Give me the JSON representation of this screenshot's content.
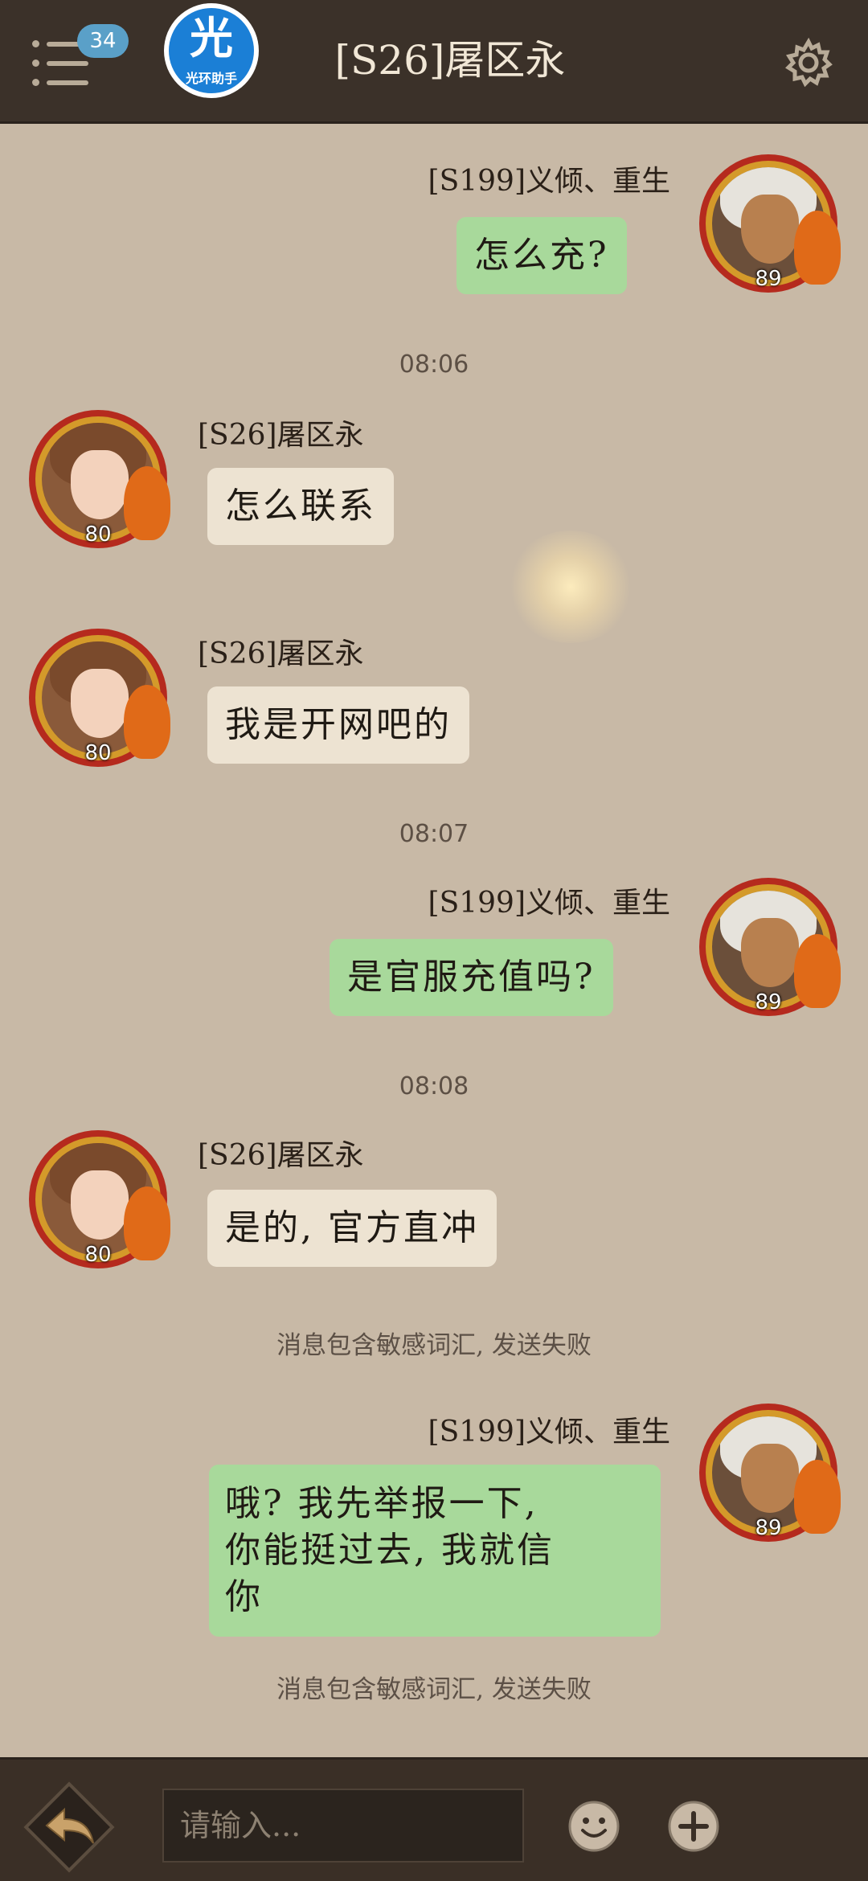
{
  "header": {
    "unread_count": "34",
    "app_logo_glyph": "光",
    "app_logo_caption": "光环助手",
    "title": "[S26]屠区永"
  },
  "messages": {
    "m1": {
      "sender": "[S199]义倾、重生",
      "text": "怎么充?",
      "level": "89"
    },
    "t1": "08:06",
    "m2": {
      "sender": "[S26]屠区永",
      "text": "怎么联系",
      "level": "80"
    },
    "m3": {
      "sender": "[S26]屠区永",
      "text": "我是开网吧的",
      "level": "80"
    },
    "t2": "08:07",
    "m4": {
      "sender": "[S199]义倾、重生",
      "text": "是官服充值吗?",
      "level": "89"
    },
    "t3": "08:08",
    "m5": {
      "sender": "[S26]屠区永",
      "text": "是的, 官方直冲",
      "level": "80"
    },
    "s1": "消息包含敏感词汇, 发送失败",
    "m6": {
      "sender": "[S199]义倾、重生",
      "line1": "哦? 我先举报一下,",
      "line2": "你能挺过去, 我就信",
      "line3": "你",
      "level": "89"
    },
    "s2": "消息包含敏感词汇, 发送失败"
  },
  "composer": {
    "placeholder": "请输入..."
  },
  "icons": {
    "menu": "menu-icon",
    "settings": "gear-icon",
    "back": "back-arrow-icon",
    "emoji": "smiley-icon",
    "add": "plus-icon"
  },
  "colors": {
    "background": "#c8b9a6",
    "header": "#3b3129",
    "bubble_self": "#a8d99b",
    "bubble_other": "#ede3d2"
  }
}
